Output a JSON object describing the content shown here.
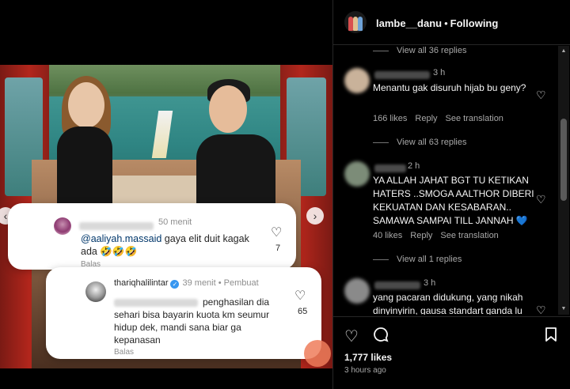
{
  "post": {
    "overlay_comment": {
      "time": "50 menit",
      "mention": "@aaliyah.massaid",
      "text": " gaya elit duit kagak ada 🤣🤣🤣",
      "reply_label": "Balas",
      "likes": "7"
    },
    "overlay_reply": {
      "username": "thariqhalilintar",
      "meta": "39 menit • Pembuat",
      "text": "penghasilan dia sehari bisa bayarin kuota km seumur hidup dek, mandi sana biar ga kepanasan",
      "reply_label": "Balas",
      "likes": "65"
    }
  },
  "header": {
    "username": "lambe__danu",
    "separator": "•",
    "follow_status": "Following"
  },
  "comments": {
    "view_replies": [
      "View all 36 replies",
      "View all 63 replies",
      "View all 1 replies"
    ],
    "items": [
      {
        "time": "3 h",
        "text": "Menantu gak disuruh hijab bu geny?",
        "likes": "166 likes",
        "reply": "Reply",
        "translate": "See translation"
      },
      {
        "time": "2 h",
        "text": "YA ALLAH JAHAT BGT TU KETIKAN HATERS ..SMOGA AALTHOR DIBERI KEKUATAN DAN KESABARAN.. SAMAWA SAMPAI TILL JANNAH 💙",
        "likes": "40 likes",
        "reply": "Reply",
        "translate": "See translation"
      },
      {
        "time": "3 h",
        "text": "yang pacaran didukung, yang nikah dinyinyirin, gausa standart ganda lu"
      }
    ]
  },
  "footer": {
    "likes": "1,777 likes",
    "posted": "3 hours ago"
  },
  "colors": {
    "mention": "#00376b",
    "verified": "#3897f0",
    "panel_bg": "#000000"
  },
  "icons": {
    "like": "heart-icon",
    "comment": "comment-bubble-icon",
    "save": "bookmark-icon",
    "verified": "verified-badge-icon"
  }
}
